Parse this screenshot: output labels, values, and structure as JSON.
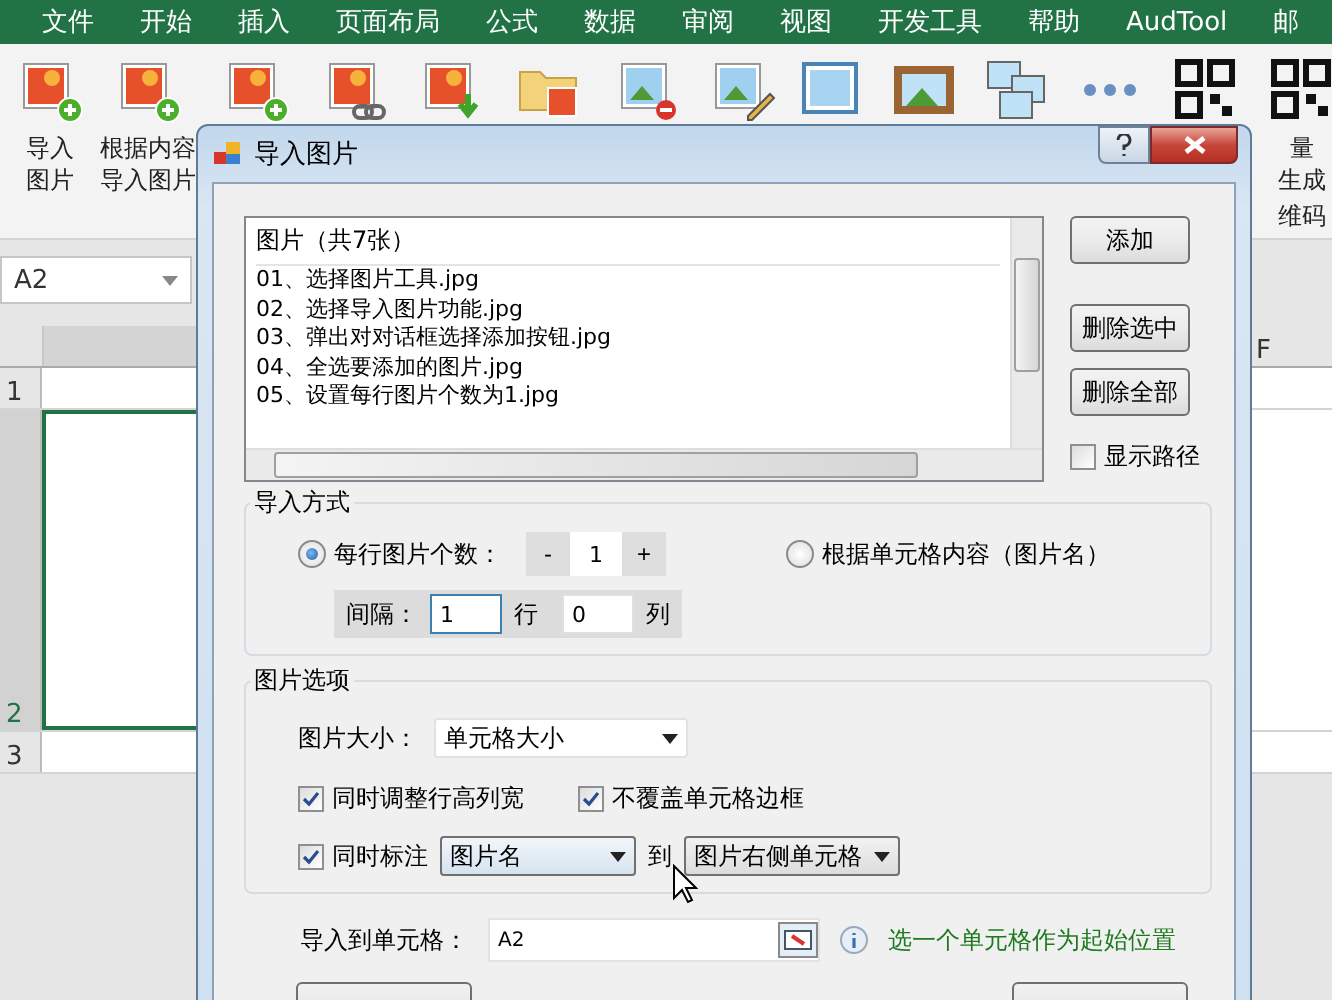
{
  "menu": [
    "文件",
    "开始",
    "插入",
    "页面布局",
    "公式",
    "数据",
    "审阅",
    "视图",
    "开发工具",
    "帮助",
    "AudTool",
    "邮"
  ],
  "ribbon": {
    "buttons": [
      {
        "kind": "picture-add",
        "lines": [
          "导入",
          "图片"
        ]
      },
      {
        "kind": "picture-add",
        "lines": [
          "根据内容",
          "导入图片"
        ]
      },
      {
        "kind": "picture-add"
      },
      {
        "kind": "picture-link"
      },
      {
        "kind": "picture-download"
      },
      {
        "kind": "folder"
      },
      {
        "kind": "picture-remove"
      },
      {
        "kind": "picture-edit"
      },
      {
        "kind": "frame"
      },
      {
        "kind": "framed-picture"
      },
      {
        "kind": "pictures"
      },
      {
        "kind": "more"
      },
      {
        "kind": "qr-code"
      },
      {
        "kind": "qr-code",
        "lines": [
          "量",
          "生成"
        ]
      }
    ],
    "group_label": "维码"
  },
  "name_box": {
    "value": "A2"
  },
  "sheet": {
    "columns": [
      "F"
    ],
    "rows": [
      {
        "label": "1",
        "selected": false
      },
      {
        "label": "2",
        "selected": true
      },
      {
        "label": "3",
        "selected": false
      }
    ]
  },
  "dialog": {
    "title": "导入图片",
    "list": {
      "header": "图片（共7张）",
      "items": [
        "01、选择图片工具.jpg",
        "02、选择导入图片功能.jpg",
        "03、弹出对对话框选择添加按钮.jpg",
        "04、全选要添加的图片.jpg",
        "05、设置每行图片个数为1.jpg"
      ]
    },
    "buttons": [
      "添加",
      "删除选中",
      "删除全部"
    ],
    "show_path": {
      "label": "显示路径",
      "checked": false
    },
    "import_mode": {
      "title": "导入方式",
      "options": [
        {
          "label": "每行图片个数：",
          "selected": true
        },
        {
          "label": "根据单元格内容（图片名）",
          "selected": false
        }
      ],
      "stepper": {
        "minus": "-",
        "value": "1",
        "plus": "+"
      },
      "spacing": {
        "label": "间隔：",
        "rows": "1",
        "rows_unit": "行",
        "cols": "0",
        "cols_unit": "列"
      }
    },
    "picture_options": {
      "title": "图片选项",
      "size_label": "图片大小：",
      "size": "单元格大小",
      "checkboxes": [
        {
          "label": "同时调整行高列宽",
          "checked": true
        },
        {
          "label": "不覆盖单元格边框",
          "checked": true
        }
      ],
      "annotate": {
        "label": "同时标注",
        "checked": true,
        "field": "图片名",
        "to": "到",
        "target": "图片右侧单元格"
      }
    },
    "target": {
      "label": "导入到单元格：",
      "value": "A2",
      "hint": "选一个单元格作为起始位置"
    }
  }
}
